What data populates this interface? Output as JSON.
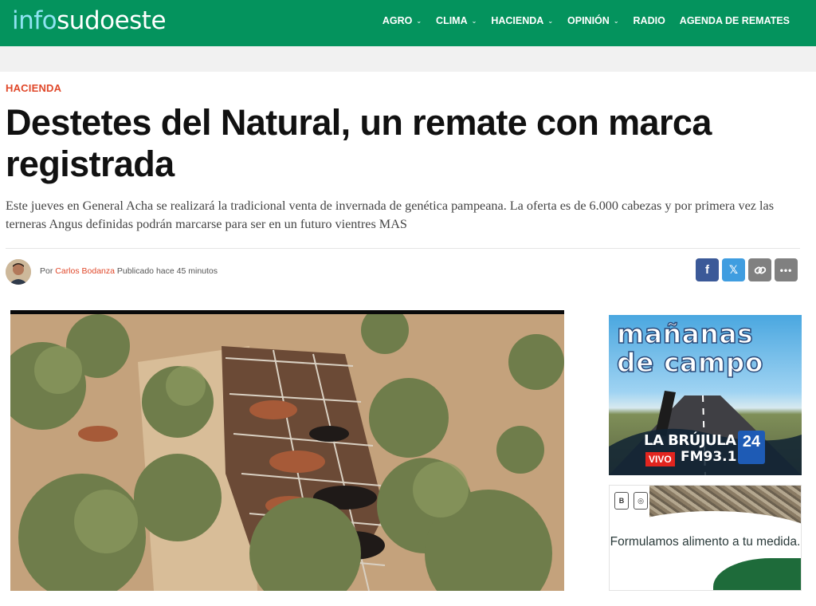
{
  "site": {
    "logo_info": "info",
    "logo_rest": "sudoeste"
  },
  "nav": {
    "items": [
      {
        "label": "AGRO",
        "dropdown": true
      },
      {
        "label": "CLIMA",
        "dropdown": true
      },
      {
        "label": "HACIENDA",
        "dropdown": true
      },
      {
        "label": "OPINIÓN",
        "dropdown": true
      },
      {
        "label": "RADIO",
        "dropdown": false
      },
      {
        "label": "AGENDA DE REMATES",
        "dropdown": false
      }
    ]
  },
  "article": {
    "category": "HACIENDA",
    "title": "Destetes del Natural, un remate con marca registrada",
    "summary": "Este jueves en General Acha se realizará la tradicional venta de invernada de genética pampeana. La oferta es de 6.000 cabezas y por primera vez las terneras Angus definidas podrán marcarse para ser en un futuro vientres MAS",
    "by_prefix": "Por",
    "author": "Carlos Bodanza",
    "published_label": "Publicado",
    "published_time": "hace 45 minutos"
  },
  "share": {
    "facebook": "f",
    "x": "𝕏",
    "more": "•••"
  },
  "ads": {
    "ad1_line1": "mañanas",
    "ad1_line2": "de campo",
    "ad1_station": "LA BRÚJULA",
    "ad1_badge": "24",
    "ad1_vivo": "VIVO",
    "ad1_freq": "FM93.1",
    "ad2_text": "Formulamos alimento a tu medida."
  },
  "colors": {
    "brand_green": "#04935d",
    "accent_red": "#e0482a",
    "facebook": "#3b5998",
    "x_blue": "#3f9de0",
    "gray_button": "#808080"
  }
}
